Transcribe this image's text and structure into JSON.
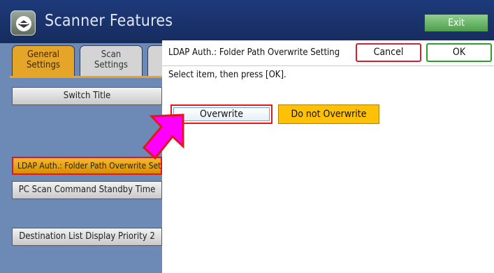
{
  "app": {
    "title": "Scanner Features",
    "exit_label": "Exit"
  },
  "tabs": [
    {
      "label_line1": "General",
      "label_line2": "Settings"
    },
    {
      "label_line1": "Scan",
      "label_line2": "Settings"
    }
  ],
  "menu": {
    "switch_title": "Switch Title",
    "ldap": "LDAP Auth.: Folder Path Overwrite Setting",
    "pc_scan": "PC Scan Command Standby Time",
    "dest_list": "Destination List Display Priority 2"
  },
  "dialog": {
    "title": "LDAP Auth.: Folder Path Overwrite Setting",
    "cancel_label": "Cancel",
    "ok_label": "OK",
    "instruction": "Select item, then press [OK].",
    "options": [
      "Overwrite",
      "Do not Overwrite"
    ]
  },
  "colors": {
    "header": "#1f3a7a",
    "panel": "#6d89b6",
    "accent": "#e5a528",
    "arrow": "#ff00ff",
    "highlight": "#e01818"
  },
  "icons": [
    "scanner-app-icon",
    "pointer-arrow-icon"
  ]
}
